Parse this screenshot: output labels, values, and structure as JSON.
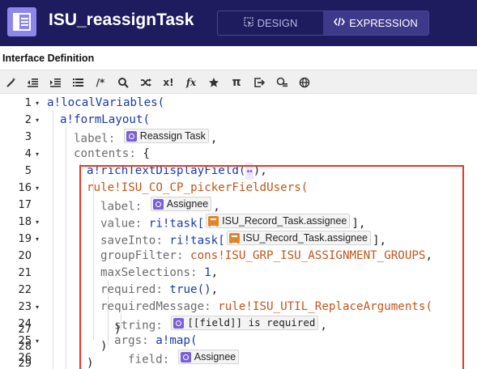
{
  "header": {
    "title": "ISU_reassignTask",
    "app_icon": "form-layout-icon",
    "tabs": [
      {
        "label": "DESIGN",
        "icon": "design-icon",
        "active": false
      },
      {
        "label": "EXPRESSION",
        "icon": "code-icon",
        "active": true
      }
    ]
  },
  "section": {
    "label": "Interface Definition"
  },
  "toolbar": {
    "buttons": [
      "format-wand-icon",
      "outdent-icon",
      "indent-icon",
      "list-icon",
      "comment-icon",
      "search-icon",
      "shuffle-icon",
      "variable-icon",
      "function-icon",
      "star-icon",
      "pi-icon",
      "export-icon",
      "test-icon",
      "globe-icon"
    ],
    "glyphs": {
      "comment": "/*",
      "variable": "x!",
      "function": "fx",
      "pi": "π"
    }
  },
  "editor": {
    "lines": [
      {
        "n": "1",
        "fold": "▾",
        "text": "a!localVariables("
      },
      {
        "n": "2",
        "fold": "▾",
        "text": "a!formLayout("
      },
      {
        "n": "3",
        "fold": "",
        "param": "label: ",
        "chip": "Reassign Task",
        "after": ","
      },
      {
        "n": "4",
        "fold": "▾",
        "param": "contents: ",
        "after": "{"
      },
      {
        "n": "5",
        "fold": "",
        "fn": "a!richTextDisplayField(",
        "arrow": "↔",
        "after": "),"
      },
      {
        "n": "16",
        "fold": "▾",
        "rule": "rule!ISU_CO_CP_pickerFieldUsers("
      },
      {
        "n": "17",
        "fold": "",
        "param": "label: ",
        "chip": "Assignee",
        "after": ","
      },
      {
        "n": "18",
        "fold": "▾",
        "param": "value: ",
        "kw": "ri!task[",
        "chip": "ISU_Record_Task.assignee",
        "after": "],"
      },
      {
        "n": "19",
        "fold": "▾",
        "param": "saveInto: ",
        "kw": "ri!task[",
        "chip": "ISU_Record_Task.assignee",
        "after": "],"
      },
      {
        "n": "20",
        "fold": "",
        "param": "groupFilter: ",
        "rule": "cons!ISU_GRP_ISU_ASSIGNMENT_GROUPS",
        "after": ","
      },
      {
        "n": "21",
        "fold": "",
        "param": "maxSelections: ",
        "num": "1",
        "after": ","
      },
      {
        "n": "22",
        "fold": "",
        "param": "required: ",
        "kw": "true()",
        "after": ","
      },
      {
        "n": "23",
        "fold": "▾",
        "param": "requiredMessage: ",
        "rule": "rule!ISU_UTIL_ReplaceArguments("
      },
      {
        "n": "24",
        "fold": "",
        "param": "string: ",
        "chip": "[[field]] is required",
        "after": ","
      },
      {
        "n": "25",
        "fold": "▾",
        "param": "args: ",
        "kw": "a!map("
      },
      {
        "n": "26",
        "fold": "",
        "param": "field: ",
        "chip": "Assignee"
      },
      {
        "n": "27",
        "fold": "",
        "after": ")"
      },
      {
        "n": "28",
        "fold": "",
        "after": ")"
      },
      {
        "n": "29",
        "fold": "",
        "after": ")"
      }
    ]
  }
}
